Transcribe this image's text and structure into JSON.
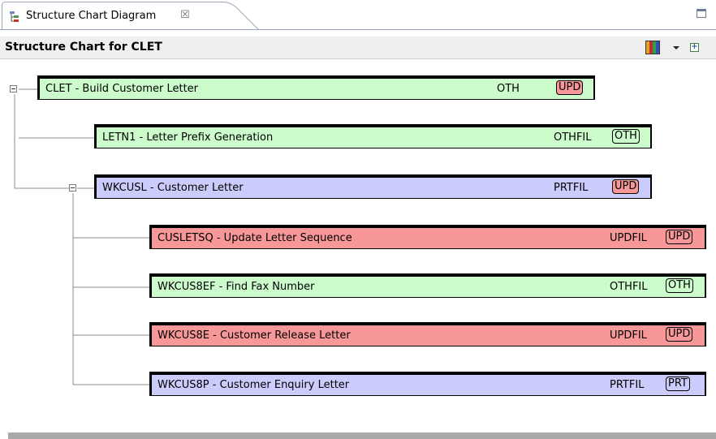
{
  "colors": {
    "green": "#ccfccc",
    "blue": "#ccccfc",
    "red": "#f79797",
    "badge_upd": "#f79797",
    "badge_oth": "#ccfccc",
    "badge_prt": "#ccccfc"
  },
  "tab": {
    "title": "Structure Chart Diagram",
    "close_glyph": "☒",
    "icon": "structure-chart-icon"
  },
  "view": {
    "title": "Structure Chart for CLET",
    "toolbar": {
      "color_legend_icon": "color-legend-icon",
      "menu_icon": "dropdown-icon",
      "expand_icon": "expand-all-icon"
    }
  },
  "nodes": [
    {
      "label": "CLET - Build Customer Letter",
      "type": "OTH",
      "badge": "UPD",
      "color": "green"
    },
    {
      "label": "LETN1 - Letter Prefix Generation",
      "type": "OTHFIL",
      "badge": "OTH",
      "color": "green"
    },
    {
      "label": "WKCUSL - Customer Letter",
      "type": "PRTFIL",
      "badge": "UPD",
      "color": "blue"
    },
    {
      "label": "CUSLETSQ - Update Letter Sequence",
      "type": "UPDFIL",
      "badge": "UPD",
      "color": "red"
    },
    {
      "label": "WKCUS8EF - Find Fax Number",
      "type": "OTHFIL",
      "badge": "OTH",
      "color": "green"
    },
    {
      "label": "WKCUS8E - Customer Release Letter",
      "type": "UPDFIL",
      "badge": "UPD",
      "color": "red"
    },
    {
      "label": "WKCUS8P - Customer Enquiry Letter",
      "type": "PRTFIL",
      "badge": "PRT",
      "color": "blue"
    }
  ]
}
